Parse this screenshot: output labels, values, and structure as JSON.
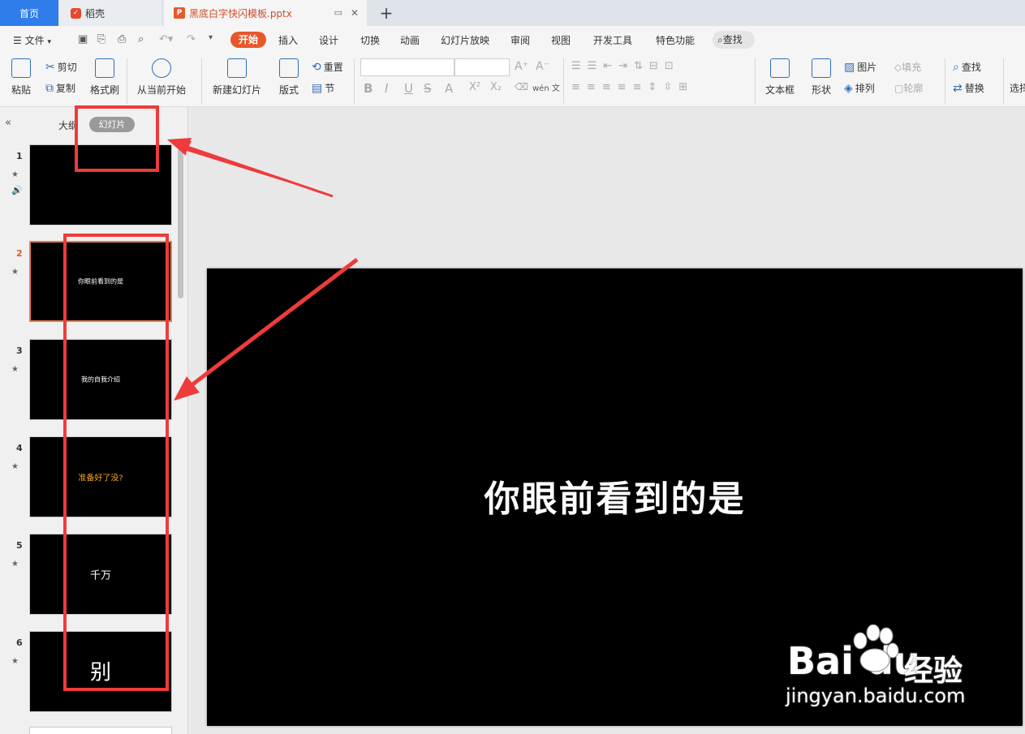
{
  "tabs": {
    "home": "首页",
    "daoke": "稻壳",
    "file": "黑底白字快闪模板.pptx",
    "add": "+"
  },
  "menu": {
    "file": "文件",
    "items": [
      "开始",
      "插入",
      "设计",
      "切换",
      "动画",
      "幻灯片放映",
      "审阅",
      "视图",
      "开发工具",
      "特色功能"
    ],
    "search": "查找"
  },
  "ribbon": {
    "paste": "粘贴",
    "cut": "剪切",
    "copy": "复制",
    "format_painter": "格式刷",
    "play_from_current": "从当前开始",
    "new_slide": "新建幻灯片",
    "layout": "版式",
    "reset": "重置",
    "section": "节",
    "textbox": "文本框",
    "shape": "形状",
    "picture": "图片",
    "fill": "填充",
    "arrange": "排列",
    "outline": "轮廓",
    "find": "查找",
    "replace": "替换",
    "select": "选择",
    "font_glyphs": {
      "bold": "B",
      "italic": "I",
      "underline": "U",
      "strike": "S",
      "font_color": "A",
      "superscript": "X²",
      "subscript": "X₂",
      "wen": "wén 文",
      "grow": "A⁺",
      "shrink": "A⁻"
    }
  },
  "panel": {
    "outline_tab": "大纲",
    "slides_tab": "幻灯片"
  },
  "slides": [
    {
      "num": "1",
      "text": "",
      "text_color": "#ffffff",
      "selected": false
    },
    {
      "num": "2",
      "text": "你眼前看到的是",
      "text_color": "#ffffff",
      "selected": true
    },
    {
      "num": "3",
      "text": "我的自我介绍",
      "text_color": "#ffffff",
      "selected": false
    },
    {
      "num": "4",
      "text": "准备好了没?",
      "text_color": "#f5a623",
      "selected": false
    },
    {
      "num": "5",
      "text": "千万",
      "text_color": "#ffffff",
      "selected": false
    },
    {
      "num": "6",
      "text": "别",
      "text_color": "#ffffff",
      "selected": false
    }
  ],
  "canvas": {
    "text": "你眼前看到的是"
  },
  "watermark": {
    "logo": "Bai du",
    "cn": "经验",
    "url": "jingyan.baidu.com"
  },
  "colors": {
    "accent": "#e8572c",
    "annotation": "#ee3b3b",
    "tab_home": "#2f7dea"
  }
}
